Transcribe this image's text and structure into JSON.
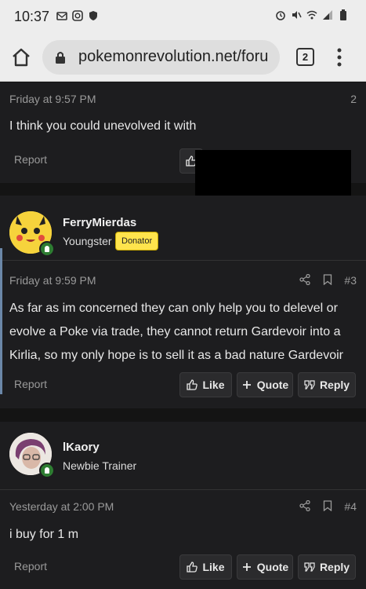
{
  "status": {
    "time": "10:37"
  },
  "browser": {
    "url": "pokemonrevolution.net/foru",
    "tab_count": "2"
  },
  "posts": [
    {
      "timestamp": "Friday at 9:57 PM",
      "number": "2",
      "text": "I think you could unevolved it with",
      "report": "Report"
    },
    {
      "username": "FerryMierdas",
      "user_title": "Youngster",
      "badge": "Donator",
      "timestamp": "Friday at 9:59 PM",
      "number": "#3",
      "text": "As far as im concerned they can only help you to delevel or evolve a Poke via trade, they cannot return Gardevoir into a Kirlia, so my only hope is to sell it as a bad nature Gardevoir",
      "report": "Report",
      "like": "Like",
      "quote": "Quote",
      "reply": "Reply"
    },
    {
      "username": "lKaory",
      "user_title": "Newbie Trainer",
      "timestamp": "Yesterday at 2:00 PM",
      "number": "#4",
      "text": "i buy for 1 m",
      "report": "Report",
      "like": "Like",
      "quote": "Quote",
      "reply": "Reply"
    }
  ],
  "colors": {
    "background": "#141414",
    "card": "#1d1d1f",
    "badge": "#ffe44d",
    "online": "#2e7d32"
  }
}
